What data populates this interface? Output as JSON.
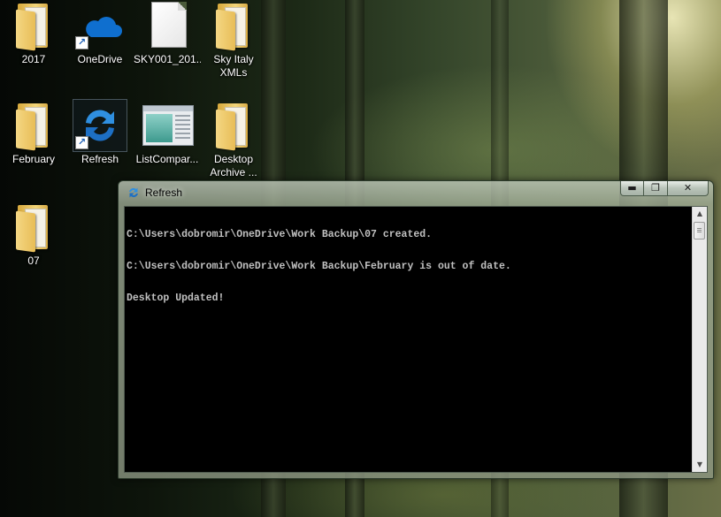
{
  "desktop": {
    "icons": [
      {
        "label": "2017",
        "type": "folder",
        "icon": "folder-icon"
      },
      {
        "label": "OneDrive",
        "type": "shortcut",
        "icon": "onedrive-icon"
      },
      {
        "label": "SKY001_201...",
        "type": "document",
        "icon": "document-icon"
      },
      {
        "label": "Sky Italy XMLs",
        "type": "folder",
        "icon": "folder-icon"
      },
      {
        "label": "February",
        "type": "folder",
        "icon": "folder-icon"
      },
      {
        "label": "Refresh",
        "type": "shortcut",
        "icon": "refresh-icon"
      },
      {
        "label": "ListCompar...",
        "type": "application",
        "icon": "app-window-icon"
      },
      {
        "label": "Desktop Archive ...",
        "type": "folder",
        "icon": "folder-icon"
      },
      {
        "label": "07",
        "type": "folder",
        "icon": "folder-icon"
      }
    ]
  },
  "window": {
    "title": "Refresh",
    "minimize_label": "▬",
    "maximize_label": "❐",
    "close_label": "✕",
    "console_lines": [
      "C:\\Users\\dobromir\\OneDrive\\Work Backup\\07 created.",
      "C:\\Users\\dobromir\\OneDrive\\Work Backup\\February is out of date.",
      "Desktop Updated!"
    ],
    "scroll_up_label": "▲",
    "scroll_down_label": "▼"
  },
  "colors": {
    "console_background": "#000000",
    "console_text": "#c0c0c0",
    "folder": "#f0c85a",
    "onedrive": "#0f6fcf",
    "refresh": "#2f8fe0"
  }
}
